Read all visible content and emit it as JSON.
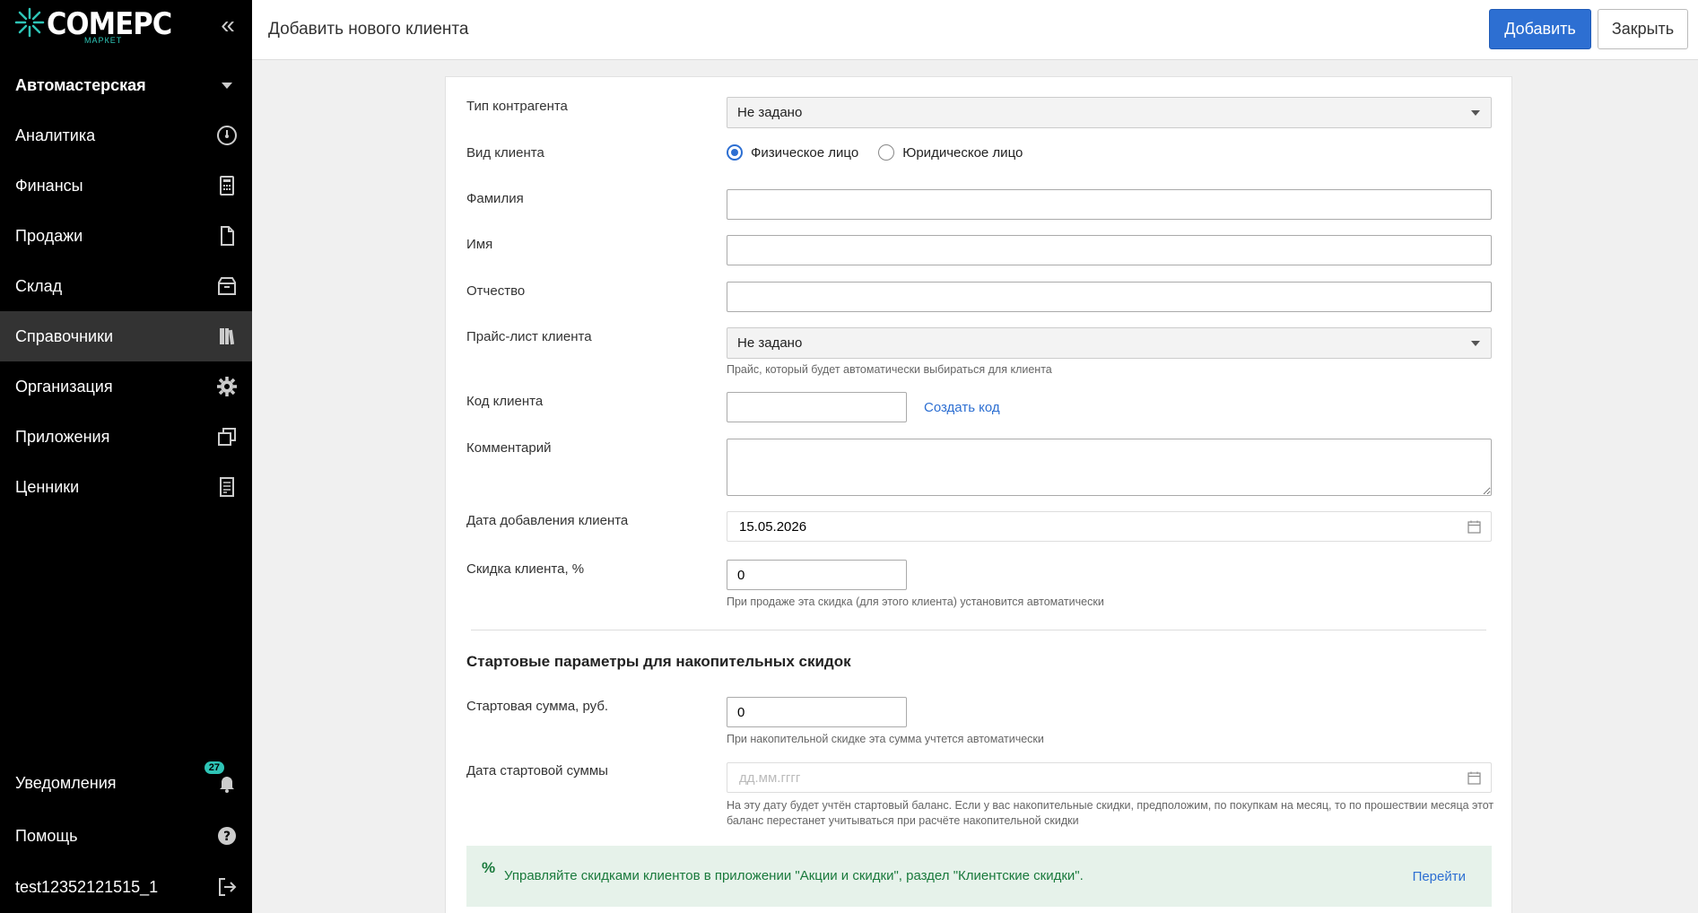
{
  "sidebar": {
    "logo_text": "СОМЕРС",
    "logo_sub": "МАРКЕТ",
    "collapse_glyph": "«",
    "workspace": "Автомастерская",
    "items": [
      {
        "label": "Аналитика",
        "icon": "gauge-icon"
      },
      {
        "label": "Финансы",
        "icon": "calculator-icon"
      },
      {
        "label": "Продажи",
        "icon": "document-icon"
      },
      {
        "label": "Склад",
        "icon": "box-icon"
      },
      {
        "label": "Справочники",
        "icon": "book-icon"
      },
      {
        "label": "Организация",
        "icon": "gear-icon"
      },
      {
        "label": "Приложения",
        "icon": "windows-icon"
      },
      {
        "label": "Ценники",
        "icon": "receipt-icon"
      }
    ],
    "notifications_label": "Уведомления",
    "notifications_count": "27",
    "help_label": "Помощь",
    "user_label": "test12352121515_1",
    "colors": {
      "accent": "#2ec4b6",
      "active_bg": "#333333"
    }
  },
  "header": {
    "title": "Добавить нового клиента",
    "add_label": "Добавить",
    "close_label": "Закрыть"
  },
  "form": {
    "counterparty_type": {
      "label": "Тип контрагента",
      "value": "Не задано"
    },
    "client_kind": {
      "label": "Вид клиента",
      "options": [
        "Физическое лицо",
        "Юридическое лицо"
      ],
      "selected": "Физическое лицо"
    },
    "last_name": {
      "label": "Фамилия",
      "value": ""
    },
    "first_name": {
      "label": "Имя",
      "value": ""
    },
    "middle_name": {
      "label": "Отчество",
      "value": ""
    },
    "price_list": {
      "label": "Прайс-лист клиента",
      "value": "Не задано",
      "hint": "Прайс, который будет автоматически выбираться для клиента"
    },
    "client_code": {
      "label": "Код клиента",
      "value": "",
      "generate_label": "Создать код"
    },
    "comment": {
      "label": "Комментарий",
      "value": ""
    },
    "date_added": {
      "label": "Дата добавления клиента",
      "value": "15.05.2026"
    },
    "discount": {
      "label": "Скидка клиента, %",
      "value": "0",
      "hint": "При продаже эта скидка (для этого клиента) установится автоматически"
    },
    "section_title": "Стартовые параметры для накопительных скидок",
    "start_sum": {
      "label": "Стартовая сумма, руб.",
      "value": "0",
      "hint": "При накопительной скидке эта сумма учтется автоматически"
    },
    "start_sum_date": {
      "label": "Дата стартовой суммы",
      "placeholder": "дд.мм.гггг",
      "hint": "На эту дату будет учтён стартовый баланс. Если у вас накопительные скидки, предположим, по покупкам на месяц, то по прошествии месяца этот баланс перестанет учитываться при расчёте накопительной скидки"
    },
    "promo": {
      "icon": "%",
      "text": "Управляйте скидками клиентов в приложении \"Акции и скидки\", раздел \"Клиентские скидки\".",
      "link_label": "Перейти"
    }
  }
}
